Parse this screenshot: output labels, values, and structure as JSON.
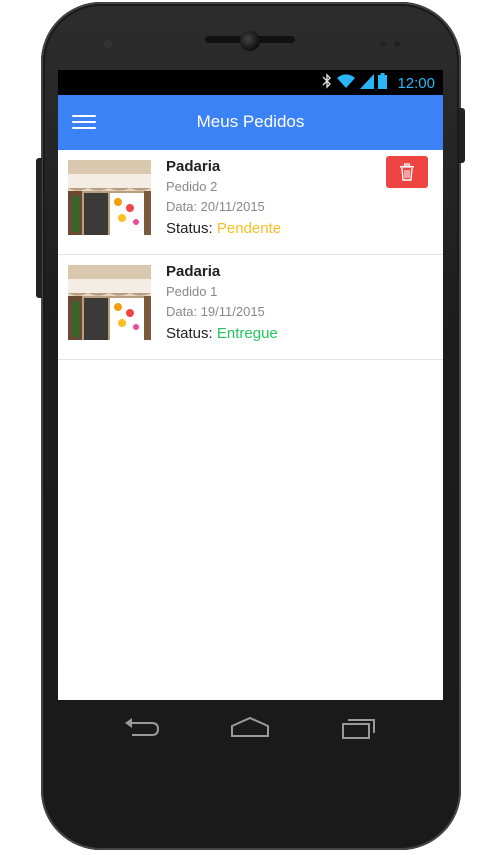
{
  "statusbar": {
    "time": "12:00",
    "icons": [
      "bluetooth-icon",
      "wifi-icon",
      "signal-icon",
      "battery-icon"
    ]
  },
  "appbar": {
    "title": "Meus Pedidos",
    "menu_icon": "hamburger-menu-icon"
  },
  "orders": [
    {
      "shop": "Padaria",
      "order": "Pedido 2",
      "date": "Data: 20/11/2015",
      "status_label": "Status:",
      "status_value": "Pendente",
      "status_color": "#fbbf24",
      "has_delete": true
    },
    {
      "shop": "Padaria",
      "order": "Pedido 1",
      "date": "Data: 19/11/2015",
      "status_label": "Status:",
      "status_value": "Entregue",
      "status_color": "#22c55e",
      "has_delete": false
    }
  ],
  "colors": {
    "primary": "#3b82f6",
    "delete": "#ef4444",
    "status_time": "#29b6f6"
  },
  "navbar": {
    "icons": [
      "back-icon",
      "home-icon",
      "recent-apps-icon"
    ]
  }
}
